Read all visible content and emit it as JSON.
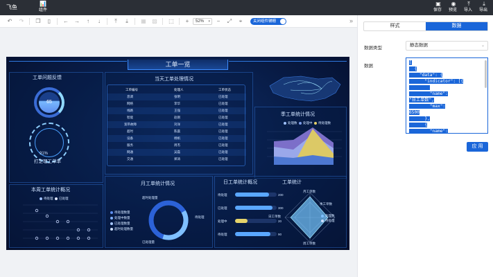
{
  "topbar": {
    "logo": "飞鱼",
    "components": {
      "icon": "bar-chart-icon",
      "label": "组件"
    },
    "actions": [
      {
        "icon": "save-icon",
        "label": "保存"
      },
      {
        "icon": "eye-icon",
        "label": "预览"
      },
      {
        "icon": "import-icon",
        "label": "导入"
      },
      {
        "icon": "export-icon",
        "label": "导出"
      }
    ]
  },
  "toolbar": {
    "zoom": "52%",
    "toggle_label": "关闭组件辅栅"
  },
  "dashboard": {
    "title": "工单一览",
    "panels": {
      "feedback": "工单问题反馈",
      "today": "当天工单处理情况",
      "quarter": "季工单统计情况",
      "week": "本周工单统计概况",
      "month": "月工单统计情况",
      "day": "日工单统计概况",
      "work": "工单统计"
    },
    "gauge_value": "65",
    "speed_value": "91%",
    "speed_label": "打定理工单率",
    "table": {
      "headers": [
        "工单编号",
        "处理人",
        "工单状态"
      ],
      "rows": [
        [
          "息调",
          "张明",
          "已处理"
        ],
        [
          "网络",
          "李华",
          "已处理"
        ],
        [
          "线路",
          "王强",
          "已处理"
        ],
        [
          "智能",
          "赵刚",
          "已处理"
        ],
        [
          "宽带故障",
          "刘洋",
          "已处理"
        ],
        [
          "超时",
          "陈晨",
          "已处理"
        ],
        [
          "设备",
          "杨帆",
          "已处理"
        ],
        [
          "服务",
          "周杰",
          "已处理"
        ],
        [
          "网通",
          "吴磊",
          "已处理"
        ],
        [
          "交通",
          "郑涛",
          "已处理"
        ]
      ]
    },
    "quarter_legend": [
      "处理数",
      "处理中",
      "待处理数"
    ],
    "week_legend": [
      "待处理",
      "已处理"
    ],
    "month_legend": [
      "待处理数量",
      "处理中数量",
      "已处理数量",
      "超时处理数量"
    ],
    "month_labels": {
      "top": "超时处理量",
      "right": "待处理",
      "bottom": "已处理量"
    },
    "day_bars": [
      {
        "label": "待处理",
        "value": "200",
        "pct": 0.82
      },
      {
        "label": "已处理",
        "value": "300",
        "pct": 0.9
      },
      {
        "label": "处理中",
        "value": "20",
        "pct": 0.3
      },
      {
        "label": "待处理",
        "value": "90",
        "pct": 0.85
      }
    ],
    "radar_labels": {
      "top": "月工单数",
      "left": "日工单数",
      "right": "季工单数",
      "bottom": "周工单数"
    },
    "radar_legend": [
      "处理数",
      "待处理"
    ]
  },
  "panel": {
    "tabs": [
      "样式",
      "数据"
    ],
    "active_tab": 1,
    "data_type_label": "数据类型",
    "data_type_value": "静态数据",
    "data_label": "数据",
    "code_lines": [
      "[",
      "  {",
      "    \"data\": {",
      "      \"indicator\": [{",
      "        ",
      "        \"name\":",
      "\"日工单数\",",
      "        \"max\":",
      "6500",
      "      },",
      "      {",
      "        \"name\":"
    ],
    "apply_label": "应 用"
  }
}
